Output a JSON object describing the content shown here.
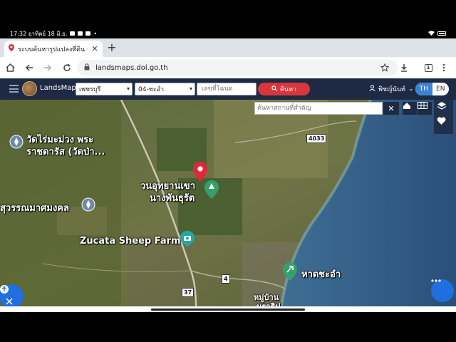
{
  "status_bar": {
    "time_date": "17:32 อาทิตย์ 18 มิ.ย."
  },
  "browser": {
    "tab_title": "ระบบค้นหารูปแปลงที่ดิน (Lands",
    "url": "landsmaps.dol.go.th",
    "tab_count": "1"
  },
  "app": {
    "brand": "LandsMaps",
    "province": "เพชรบุรี",
    "district": "04-ชะอำ",
    "deed_placeholder": "เลขที่โฉนด",
    "search_label": "ค้นหา",
    "user_name": "พิชญ์นันท์",
    "lang_th": "TH",
    "lang_en": "EN"
  },
  "map": {
    "search_placeholder": "ค้นหาสถานที่สำคัญ",
    "clear_label": "✕",
    "labels": {
      "temple": "วัดไร่มะม่วง พระ",
      "temple2": "ราชดารัส (วัดป่า...",
      "park": "วนอุทยานเขา",
      "park2": "นางพันธุรัต",
      "school": "สุวรรณมาศมงคล",
      "farm": "Zucata Sheep Farm",
      "beach": "หาดชะอำ",
      "village": "หมู่บ้าน",
      "village2": "นราธิป"
    },
    "road_shields": [
      "4033",
      "4",
      "37"
    ]
  },
  "colors": {
    "app_header": "#1e2a44",
    "search_button": "#d8353d",
    "pin": "#e0273a",
    "accent_blue": "#1f6fe0"
  }
}
